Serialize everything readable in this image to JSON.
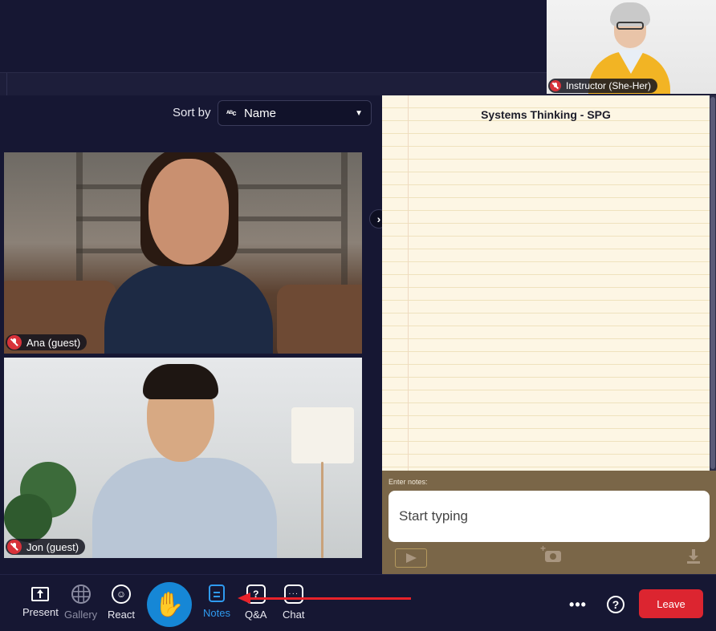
{
  "instructor": {
    "name_tag": "Instructor (She-Her)",
    "muted": true
  },
  "sort": {
    "label": "Sort by",
    "selected": "Name",
    "icon": "abc-sort-icon"
  },
  "participants": [
    {
      "name_tag": "Ana (guest)",
      "muted": true
    },
    {
      "name_tag": "Jon (guest)",
      "muted": true
    }
  ],
  "notes": {
    "title": "Systems Thinking - SPG",
    "enter_label": "Enter notes:",
    "placeholder": "Start typing"
  },
  "toolbar": {
    "present": "Present",
    "gallery": "Gallery",
    "react": "React",
    "notes": "Notes",
    "qa": "Q&A",
    "chat": "Chat",
    "leave": "Leave"
  },
  "colors": {
    "background": "#161733",
    "accent": "#1687d6",
    "notes_active": "#2f9bf0",
    "leave": "#dc2530",
    "annotation_arrow": "#e8222a"
  }
}
